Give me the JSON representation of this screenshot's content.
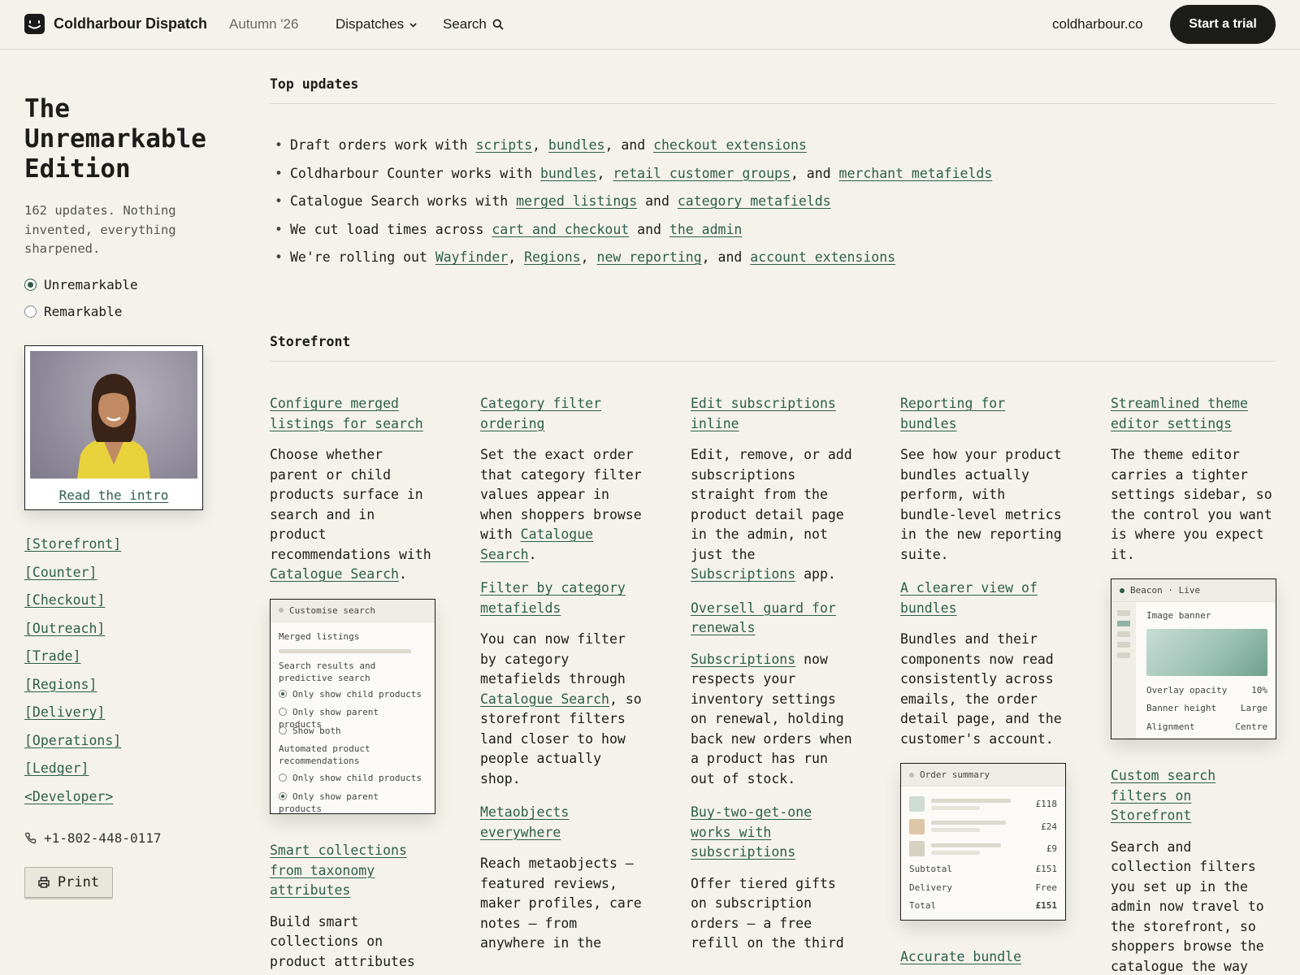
{
  "header": {
    "brand": "Coldharbour Dispatch",
    "season": "Autumn '26",
    "nav_dispatches": "Dispatches",
    "nav_search": "Search",
    "domain": "coldharbour.co",
    "cta": "Start a trial"
  },
  "sidebar": {
    "title_lines": [
      "The",
      "Unremarkable",
      "Edition"
    ],
    "subtitle": "162 updates. Nothing invented, everything sharpened.",
    "options": [
      "Unremarkable",
      "Remarkable"
    ],
    "selected_option": "Unremarkable",
    "intro_link": "Read the intro",
    "sections": [
      "[Storefront]",
      "[Counter]",
      "[Checkout]",
      "[Outreach]",
      "[Trade]",
      "[Regions]",
      "[Delivery]",
      "[Operations]",
      "[Ledger]",
      "<Developer>"
    ],
    "phone": "+1-802-448-0117",
    "print": "Print"
  },
  "top_updates": {
    "heading": "Top updates",
    "items": [
      [
        {
          "t": "Draft orders work with "
        },
        {
          "l": "scripts"
        },
        {
          "t": ", "
        },
        {
          "l": "bundles"
        },
        {
          "t": ", and "
        },
        {
          "l": "checkout extensions"
        }
      ],
      [
        {
          "t": "Coldharbour Counter works with "
        },
        {
          "l": "bundles"
        },
        {
          "t": ", "
        },
        {
          "l": "retail customer groups"
        },
        {
          "t": ", and "
        },
        {
          "l": "merchant metafields"
        }
      ],
      [
        {
          "t": "Catalogue Search works with "
        },
        {
          "l": "merged listings"
        },
        {
          "t": " and "
        },
        {
          "l": "category metafields"
        }
      ],
      [
        {
          "t": "We cut load times across "
        },
        {
          "l": "cart and checkout"
        },
        {
          "t": " and "
        },
        {
          "l": "the admin"
        }
      ],
      [
        {
          "t": "We're rolling out "
        },
        {
          "l": "Wayfinder"
        },
        {
          "t": ", "
        },
        {
          "l": "Regions"
        },
        {
          "t": ", "
        },
        {
          "l": "new reporting"
        },
        {
          "t": ", and "
        },
        {
          "l": "account extensions"
        }
      ]
    ]
  },
  "storefront": {
    "heading": "Storefront",
    "columns": [
      {
        "features": [
          {
            "title": "Configure merged listings for search",
            "body": [
              {
                "t": "Choose whether parent or child products surface in search and in product recommendations with "
              },
              {
                "l": "Catalogue Search"
              },
              {
                "t": "."
              }
            ]
          },
          {
            "mock": "customise"
          },
          {
            "title": "Smart collections from taxonomy attributes",
            "body": [
              {
                "t": "Build smart collections on product attributes"
              }
            ]
          }
        ]
      },
      {
        "features": [
          {
            "title": "Category filter ordering",
            "body": [
              {
                "t": "Set the exact order that category filter values appear in when shoppers browse with "
              },
              {
                "l": "Catalogue Search"
              },
              {
                "t": "."
              }
            ]
          },
          {
            "title": "Filter by category metafields",
            "body": [
              {
                "t": "You can now filter by category metafields through "
              },
              {
                "l": "Catalogue Search"
              },
              {
                "t": ", so storefront filters land closer to how people actually shop."
              }
            ]
          },
          {
            "title": "Metaobjects everywhere",
            "body": [
              {
                "t": "Reach metaobjects — featured reviews, maker profiles, care notes — from anywhere in the"
              }
            ]
          }
        ]
      },
      {
        "features": [
          {
            "title": "Edit subscriptions inline",
            "body": [
              {
                "t": "Edit, remove, or add subscriptions straight from the product detail page in the admin, not just the "
              },
              {
                "l": "Subscriptions"
              },
              {
                "t": " app."
              }
            ]
          },
          {
            "title": "Oversell guard for renewals",
            "body": [
              {
                "l": "Subscriptions"
              },
              {
                "t": " now respects your inventory settings on renewal, holding back new orders when a product has run out of stock."
              }
            ]
          },
          {
            "title": "Buy-two-get-one works with subscriptions",
            "body": [
              {
                "t": "Offer tiered gifts on subscription orders — a free refill on the third"
              }
            ]
          }
        ]
      },
      {
        "features": [
          {
            "title": "Reporting for bundles",
            "body": [
              {
                "t": "See how your product bundles actually perform, with bundle-level metrics in the new reporting suite."
              }
            ]
          },
          {
            "title": "A clearer view of bundles",
            "body": [
              {
                "t": "Bundles and their components now read consistently across emails, the order detail page, and the customer's account."
              }
            ]
          },
          {
            "mock": "order"
          },
          {
            "title": "Accurate bundle",
            "body": []
          }
        ]
      },
      {
        "features": [
          {
            "title": "Streamlined theme editor settings",
            "body": [
              {
                "t": "The theme editor carries a tighter settings sidebar, so the control you want is where you expect it."
              }
            ]
          },
          {
            "mock": "beacon"
          },
          {
            "title": "Custom search filters on Storefront",
            "body": [
              {
                "t": "Search and collection filters you set up in the admin now travel to the storefront, so shoppers browse the catalogue the way"
              }
            ]
          }
        ]
      }
    ]
  },
  "mock_customise": {
    "title": "Customise search",
    "merged": "Merged listings",
    "group1": "Search results and predictive search",
    "opts1": [
      "Only show child products",
      "Only show parent products",
      "Show both"
    ],
    "opts1_selected": 0,
    "group2": "Automated product recommendations",
    "opts2": [
      "Only show child products",
      "Only show parent products"
    ],
    "opts2_selected": 1
  },
  "mock_order": {
    "title": "Order summary",
    "lines": [
      "£118",
      "£24",
      "£9"
    ],
    "thumb_colors": [
      "#cfdcd6",
      "#ddc6a8",
      "#d6d0c0"
    ],
    "subtotal_label": "Subtotal",
    "subtotal": "£151",
    "delivery_label": "Delivery",
    "delivery": "Free",
    "total_label": "Total",
    "total": "£151"
  },
  "mock_beacon": {
    "title": "Beacon  ·  Live",
    "section": "Image banner",
    "rows": [
      {
        "label": "Overlay opacity",
        "value": "10%"
      },
      {
        "label": "Banner height",
        "value": "Large"
      },
      {
        "label": "Alignment",
        "value": "Centre"
      }
    ]
  }
}
